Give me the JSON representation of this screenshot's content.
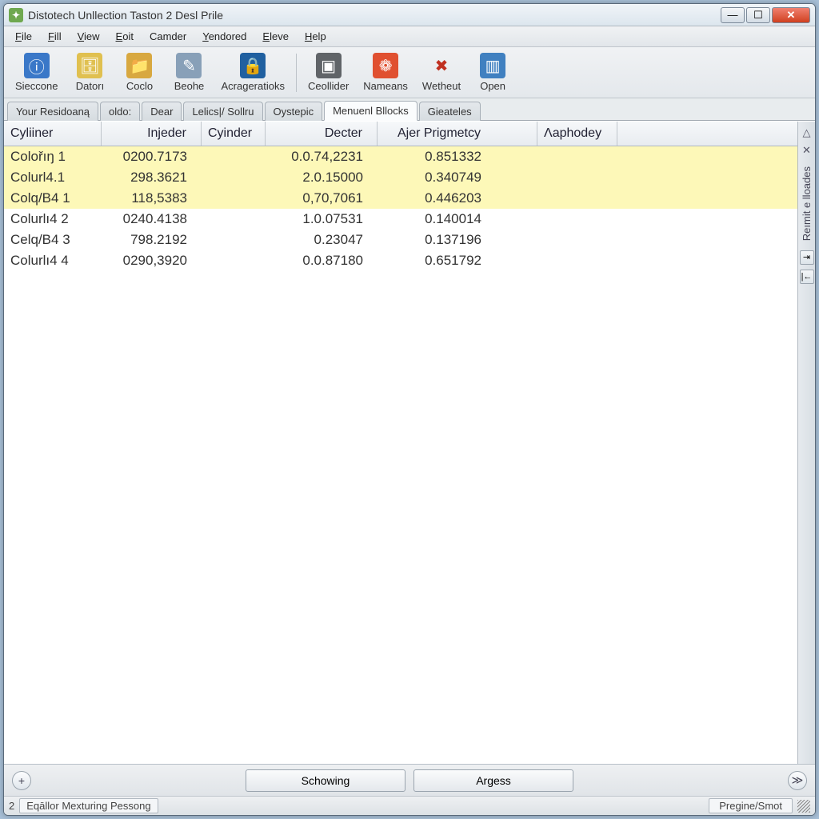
{
  "window": {
    "title": "Distotech Unllection Taston 2 Desl Prile"
  },
  "menu": {
    "items": [
      {
        "label": "File",
        "u": 0
      },
      {
        "label": "Fill",
        "u": 0
      },
      {
        "label": "View",
        "u": 0
      },
      {
        "label": "Eoit",
        "u": 0
      },
      {
        "label": "Camder",
        "u": -1
      },
      {
        "label": "Yendored",
        "u": 0
      },
      {
        "label": "Eleve",
        "u": 0
      },
      {
        "label": "Help",
        "u": 0
      }
    ]
  },
  "toolbar": {
    "buttons": [
      {
        "label": "Sieccone",
        "icon": "info-icon",
        "bg": "#3a78c8"
      },
      {
        "label": "Datorı",
        "icon": "cylinder-icon",
        "bg": "#e0c050"
      },
      {
        "label": "Coclo",
        "icon": "folder-icon",
        "bg": "#d8a840"
      },
      {
        "label": "Beohe",
        "icon": "wand-icon",
        "bg": "#88a0b8"
      },
      {
        "label": "Acrageratioks",
        "icon": "lock-icon",
        "bg": "#2060a0"
      },
      {
        "label": "Ceollider",
        "icon": "device-icon",
        "bg": "#606468"
      },
      {
        "label": "Nameans",
        "icon": "palette-icon",
        "bg": "#e05030"
      },
      {
        "label": "Wetheut",
        "icon": "x-icon",
        "bg": "transparent"
      },
      {
        "label": "Open",
        "icon": "window-icon",
        "bg": "#4080c0"
      }
    ]
  },
  "tabs": {
    "items": [
      {
        "label": "Your Residoaną",
        "active": false
      },
      {
        "label": "oldo:",
        "active": false
      },
      {
        "label": "Dear",
        "active": false
      },
      {
        "label": "Lelics|/ Sollru",
        "active": false
      },
      {
        "label": "Oystepic",
        "active": false
      },
      {
        "label": "Menuenl Bllocks",
        "active": true
      },
      {
        "label": "Gieateles",
        "active": false
      }
    ]
  },
  "grid": {
    "headers": [
      "Cyliiner",
      "Injeder",
      "Cyinder",
      "Decter",
      "Ajer Prigmetcy",
      "Λaphodey"
    ],
    "rows": [
      {
        "sel": true,
        "cells": [
          "Colořıŋ 1",
          "0200.7173",
          "",
          "0.0.74,2231",
          "0.851332",
          ""
        ]
      },
      {
        "sel": true,
        "cells": [
          "Colurl4.1",
          "298.3621",
          "",
          "2.0.15000",
          "0.340749",
          ""
        ]
      },
      {
        "sel": true,
        "cells": [
          "Colq/B4 1",
          "118,5383",
          "",
          "0,70,7061",
          "0.446203",
          ""
        ]
      },
      {
        "sel": false,
        "cells": [
          "Colurlı4 2",
          "0240.4138",
          "",
          "1.0.07531",
          "0.140014",
          ""
        ]
      },
      {
        "sel": false,
        "cells": [
          "Celq/B4 3",
          "798.2192",
          "",
          "0.23047",
          "0.137196",
          ""
        ]
      },
      {
        "sel": false,
        "cells": [
          "Colurlı4 4",
          "0290,3920",
          "",
          "0.0.87180",
          "0.651792",
          ""
        ]
      }
    ]
  },
  "sidebar": {
    "up": "△",
    "close": "✕",
    "label": "Reımit e lloades",
    "btn1": "⇥",
    "btn2": "|←"
  },
  "bottom": {
    "left": "+",
    "btn1": "Schowing",
    "btn2": "Argess",
    "right": "≫"
  },
  "status": {
    "left_prefix": "2",
    "left": "Eqāllor Mexturing Pessong",
    "right": "Pregine/Smot"
  }
}
